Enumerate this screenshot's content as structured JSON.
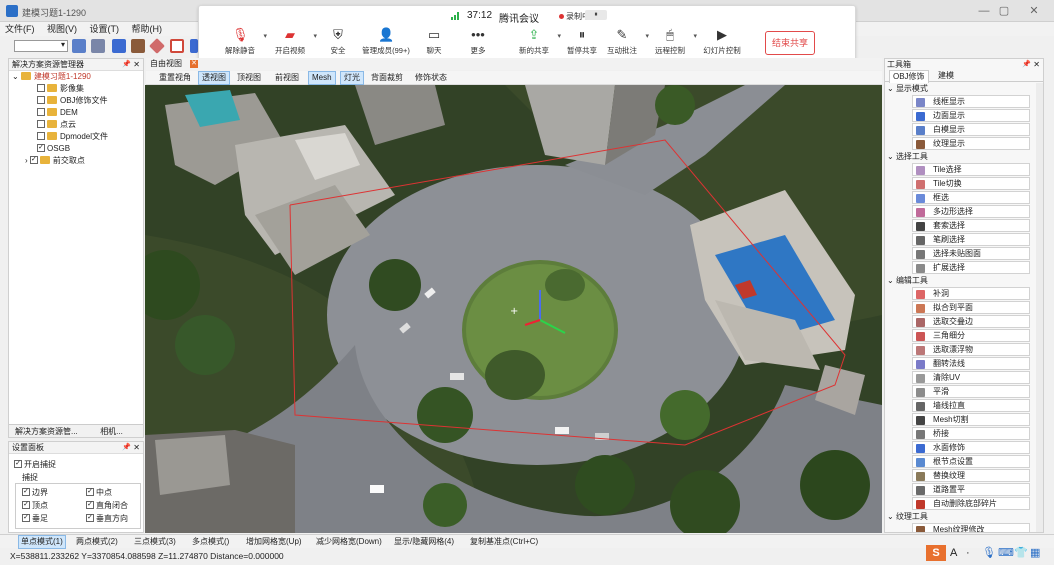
{
  "window": {
    "title": "建模习题1-1290"
  },
  "menu": [
    "文件(F)",
    "视图(V)",
    "设置(T)",
    "帮助(H)"
  ],
  "meeting": {
    "time": "37:12",
    "title": "腾讯会议",
    "recording": "录制中",
    "pause": "⏸",
    "buttons": [
      {
        "label": "解除静音",
        "icon": "mic-muted-icon",
        "glyph": "🎙"
      },
      {
        "label": "开启视频",
        "icon": "camera-off-icon",
        "glyph": "▰"
      },
      {
        "label": "安全",
        "icon": "shield-icon",
        "glyph": "⛨"
      },
      {
        "label": "管理成员(99+)",
        "icon": "members-icon",
        "glyph": "👤"
      },
      {
        "label": "聊天",
        "icon": "chat-icon",
        "glyph": "▭"
      },
      {
        "label": "更多",
        "icon": "more-icon",
        "glyph": "•••"
      },
      {
        "label": "新的共享",
        "icon": "new-share-icon",
        "glyph": "⇪"
      },
      {
        "label": "暂停共享",
        "icon": "pause-share-icon",
        "glyph": "⏸"
      },
      {
        "label": "互动批注",
        "icon": "annotate-icon",
        "glyph": "✎"
      },
      {
        "label": "远程控制",
        "icon": "remote-control-icon",
        "glyph": "🖱"
      },
      {
        "label": "幻灯片控制",
        "icon": "slideshow-icon",
        "glyph": "▶"
      }
    ],
    "end_share": "结束共享"
  },
  "left_panel": {
    "title": "解决方案资源管理器",
    "root": "建模习题1-1290",
    "items": [
      {
        "label": "影像集",
        "checked": false,
        "folder": true
      },
      {
        "label": "OBJ修饰文件",
        "checked": false,
        "folder": true
      },
      {
        "label": "DEM",
        "checked": false,
        "folder": true
      },
      {
        "label": "点云",
        "checked": false,
        "folder": true
      },
      {
        "label": "Dpmodel文件",
        "checked": false,
        "folder": true
      },
      {
        "label": "OSGB",
        "checked": true,
        "folder": false
      },
      {
        "label": "前交取点",
        "checked": true,
        "folder": true
      }
    ],
    "tabs": [
      "解决方案资源管...",
      "相机..."
    ]
  },
  "settings": {
    "title": "设置面板",
    "enable_snap": "开启捕捉",
    "snap_group": "捕捉",
    "options": [
      {
        "label": "边界",
        "checked": true
      },
      {
        "label": "中点",
        "checked": true
      },
      {
        "label": "顶点",
        "checked": true
      },
      {
        "label": "直角闭合",
        "checked": true
      },
      {
        "label": "垂足",
        "checked": true
      },
      {
        "label": "垂直方向",
        "checked": true
      }
    ]
  },
  "view": {
    "tab": "自由视图",
    "subtabs": [
      "重置视角",
      "透视图",
      "顶视图",
      "前视图",
      "Mesh",
      "灯光",
      "背面裁剪",
      "修饰状态"
    ],
    "active_subtabs": [
      "透视图",
      "Mesh",
      "灯光"
    ]
  },
  "toolbox": {
    "title": "工具箱",
    "tabs": [
      "OBJ修饰",
      "建模"
    ],
    "sections": [
      {
        "name": "显示模式",
        "items": [
          "线框显示",
          "边面显示",
          "白模显示",
          "纹理显示"
        ]
      },
      {
        "name": "选择工具",
        "items": [
          "Tile选择",
          "Tile切换",
          "框选",
          "多边形选择",
          "套索选择",
          "笔刷选择",
          "选择未贴图面",
          "扩展选择"
        ]
      },
      {
        "name": "编辑工具",
        "items": [
          "补洞",
          "拟合到平面",
          "选取交叠边",
          "三角细分",
          "选取漂浮物",
          "翻转法线",
          "清除UV",
          "平滑",
          "墙线拉直",
          "Mesh切割",
          "桥接",
          "水面修饰",
          "根节点设置",
          "替换纹理",
          "道路置平",
          "自动删除底部碎片"
        ]
      },
      {
        "name": "纹理工具",
        "items": [
          "Mesh纹理修改"
        ]
      }
    ]
  },
  "modes": [
    "单点模式(1)",
    "两点模式(2)",
    "三点模式(3)",
    "多点模式()",
    "增加网格宽(Up)",
    "减少网格宽(Down)",
    "显示/隐藏网格(4)",
    "复制基准点(Ctrl+C)"
  ],
  "status": {
    "coords": "X=538811.233262  Y=3370854.088598  Z=11.274870  Distance=0.000000"
  },
  "colors": {
    "accent": "#2b6fc7",
    "end_share": "#e24a4a",
    "folder": "#e8b33b",
    "root_text": "#c0392b"
  }
}
